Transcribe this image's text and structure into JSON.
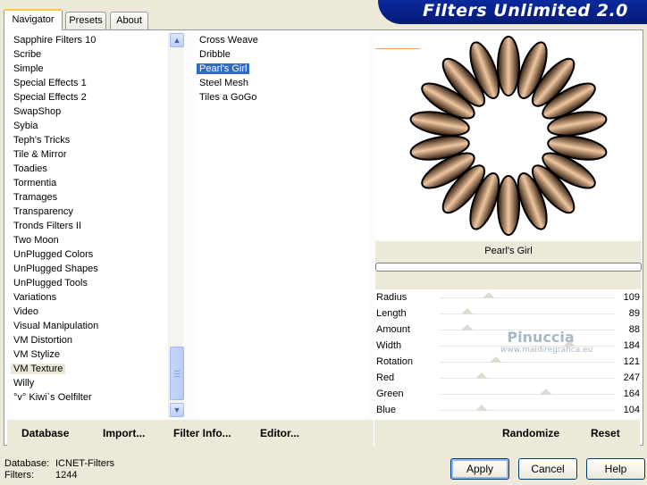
{
  "window_title": "Filters Unlimited 2.0",
  "tabs": [
    {
      "label": "Navigator",
      "active": true
    },
    {
      "label": "Presets",
      "active": false
    },
    {
      "label": "About",
      "active": false
    }
  ],
  "categories": {
    "items": [
      "Sapphire Filters 10",
      "Scribe",
      "Simple",
      "Special Effects 1",
      "Special Effects 2",
      "SwapShop",
      "Sybia",
      "Teph's Tricks",
      "Tile & Mirror",
      "Toadies",
      "Tormentia",
      "Tramages",
      "Transparency",
      "Tronds Filters II",
      "Two Moon",
      "UnPlugged Colors",
      "UnPlugged Shapes",
      "UnPlugged Tools",
      "Variations",
      "Video",
      "Visual Manipulation",
      "VM Distortion",
      "VM Stylize",
      "VM Texture",
      "Willy",
      "°v° Kiwi`s Oelfilter"
    ],
    "selected": "VM Texture"
  },
  "filters": {
    "items": [
      "Cross Weave",
      "Dribble",
      "Pearl's Girl",
      "Steel Mesh",
      "Tiles a GoGo"
    ],
    "selected": "Pearl's Girl"
  },
  "preview": {
    "filter_name": "Pearl's Girl",
    "progress_fraction": 0.0,
    "petal_count": 18,
    "colors": {
      "petal_dark": "#2a1708",
      "petal_mid": "#8a5430",
      "petal_light": "#f0c6a0"
    }
  },
  "sliders": [
    {
      "label": "Radius",
      "value": "109"
    },
    {
      "label": "Length",
      "value": "89"
    },
    {
      "label": "Amount",
      "value": "88"
    },
    {
      "label": "Width",
      "value": "184"
    },
    {
      "label": "Rotation",
      "value": "121"
    },
    {
      "label": "Red",
      "value": "247"
    },
    {
      "label": "Green",
      "value": "164"
    },
    {
      "label": "Blue",
      "value": "104"
    }
  ],
  "watermark": {
    "line1": "Pinuccia",
    "line2": "www.maidiregrafica.eu"
  },
  "bottom_bar": {
    "database": "Database",
    "import": "Import...",
    "filter_info": "Filter Info...",
    "editor": "Editor...",
    "randomize": "Randomize",
    "reset": "Reset"
  },
  "footer": {
    "database_label": "Database:",
    "database_value": "ICNET-Filters",
    "filters_label": "Filters:",
    "filters_value": "1244",
    "apply": "Apply",
    "cancel": "Cancel",
    "help": "Help"
  },
  "icons": {
    "scroll_up": "▲",
    "scroll_down": "▼"
  },
  "theme": {
    "selection_blue": "#316ac5",
    "banner_blue": "#0a2a9c",
    "tab_accent": "#ffc83c"
  }
}
